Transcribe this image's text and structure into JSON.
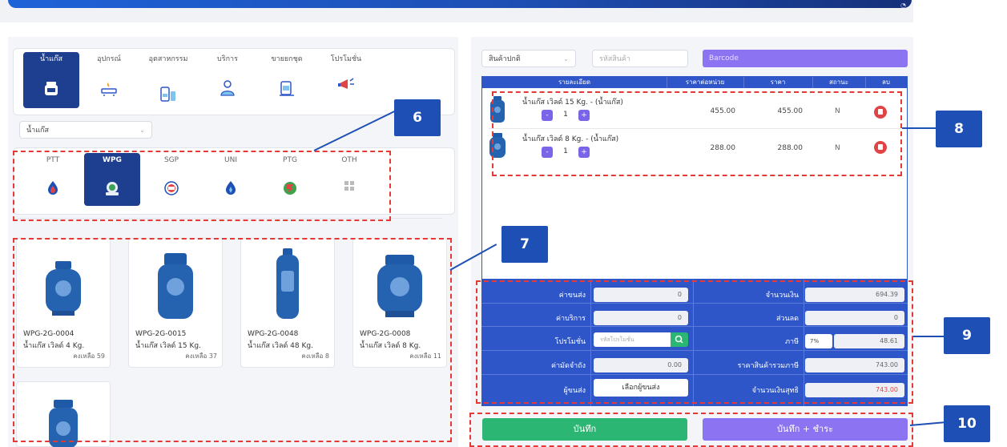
{
  "categories": [
    {
      "label": "น้ำแก๊ส",
      "icon": "gas-refill-icon"
    },
    {
      "label": "อุปกรณ์",
      "icon": "gas-stove-icon"
    },
    {
      "label": "อุตสาหกรรม",
      "icon": "industrial-tank-icon"
    },
    {
      "label": "บริการ",
      "icon": "service-person-icon"
    },
    {
      "label": "ขายยกชุด",
      "icon": "set-bundle-icon"
    },
    {
      "label": "โปรโมชั่น",
      "icon": "promotion-megaphone-icon"
    }
  ],
  "category_select": {
    "value": "น้ำแก๊ส"
  },
  "brands": [
    {
      "label": "PTT",
      "icon": "ptt-flame-icon"
    },
    {
      "label": "WPG",
      "icon": "wpg-logo-icon"
    },
    {
      "label": "SGP",
      "icon": "sgp-logo-icon"
    },
    {
      "label": "UNI",
      "icon": "uni-logo-icon"
    },
    {
      "label": "PTG",
      "icon": "ptg-logo-icon"
    },
    {
      "label": "OTH",
      "icon": "grid-icon"
    }
  ],
  "products": [
    {
      "code": "WPG-2G-0004",
      "name": "น้ำแก๊ส เวิลด์ 4 Kg.",
      "stock": "คงเหลือ 59"
    },
    {
      "code": "WPG-2G-0015",
      "name": "น้ำแก๊ส เวิลด์ 15 Kg.",
      "stock": "คงเหลือ 37"
    },
    {
      "code": "WPG-2G-0048",
      "name": "น้ำแก๊ส เวิลด์ 48 Kg.",
      "stock": "คงเหลือ 8"
    },
    {
      "code": "WPG-2G-0008",
      "name": "น้ำแก๊ส เวิลด์ 8 Kg.",
      "stock": "คงเหลือ 11"
    }
  ],
  "search": {
    "type_select": "สินค้าปกติ",
    "code_placeholder": "รหัสสินค้า",
    "barcode_label": "Barcode"
  },
  "cart": {
    "headers": {
      "detail": "รายละเอียด",
      "unit_price": "ราคาต่อหน่วย",
      "price": "ราคา",
      "status": "สถานะ",
      "delete": "ลบ"
    },
    "items": [
      {
        "name": "น้ำแก๊ส เวิลด์ 15 Kg. - (น้ำแก๊ส)",
        "qty": "1",
        "unit_price": "455.00",
        "price": "455.00",
        "status": "N"
      },
      {
        "name": "น้ำแก๊ส เวิลด์ 8 Kg. - (น้ำแก๊ส)",
        "qty": "1",
        "unit_price": "288.00",
        "price": "288.00",
        "status": "N"
      }
    ],
    "minus": "-",
    "plus": "+"
  },
  "summary": {
    "shipping_label": "ค่าขนส่ง",
    "shipping_value": "0",
    "service_label": "ค่าบริการ",
    "service_value": "0",
    "promo_label": "โปรโมชั่น",
    "promo_placeholder": "รหัสโปรโมชั่น",
    "deposit_label": "ค่ามัดจำถัง",
    "deposit_value": "0.00",
    "sender_label": "ผู้ขนส่ง",
    "sender_button": "เลือกผู้ขนส่ง",
    "amount_label": "จำนวนเงิน",
    "amount_value": "694.39",
    "discount_label": "ส่วนลด",
    "discount_value": "0",
    "vat_label": "ภาษี",
    "vat_percent": "7%",
    "vat_value": "48.61",
    "total_incl_label": "ราคาสินค้ารวมภาษี",
    "total_incl_value": "743.00",
    "net_label": "จำนวนเงินสุทธิ",
    "net_value": "743.00"
  },
  "actions": {
    "save": "บันทึก",
    "save_pay": "บันทึก + ชำระ"
  },
  "annotations": [
    "6",
    "7",
    "8",
    "9",
    "10"
  ],
  "colors": {
    "primary_blue": "#2f56c8",
    "dark_blue": "#1e3f8f",
    "purple": "#8b73f2",
    "green": "#2bb673",
    "red": "#e53935"
  }
}
